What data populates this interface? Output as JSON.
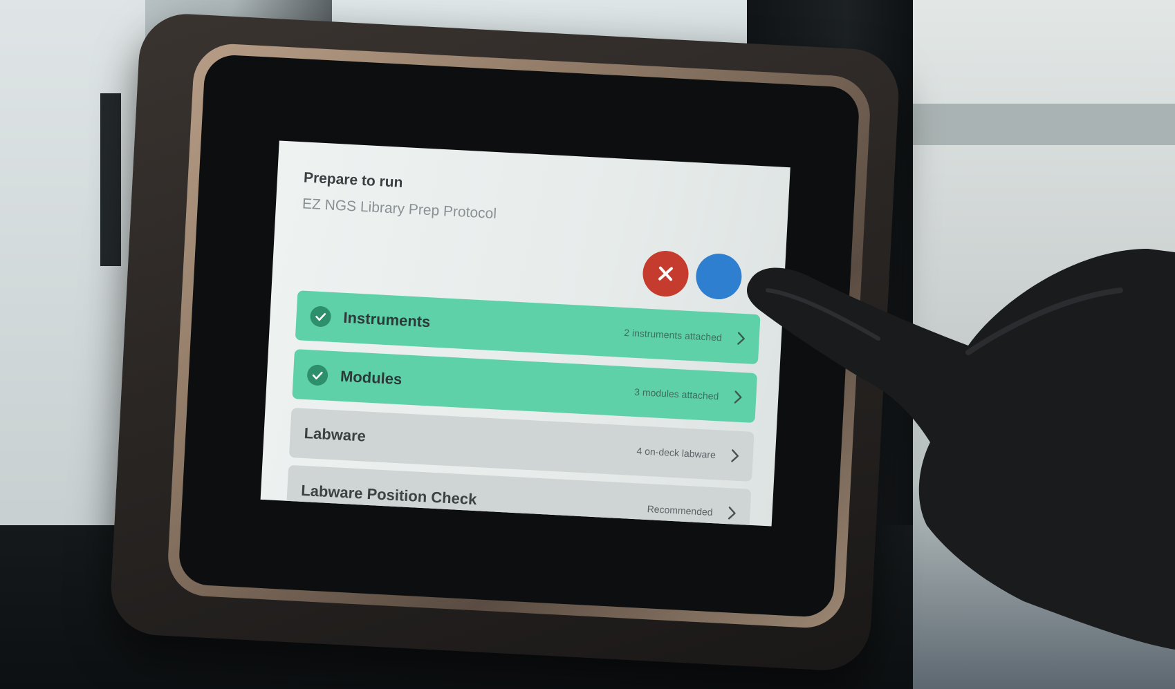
{
  "header": {
    "title": "Prepare to run",
    "subtitle": "EZ NGS Library Prep Protocol"
  },
  "actions": {
    "cancel_icon": "close-icon",
    "confirm_icon": "confirm-icon"
  },
  "setup_steps": [
    {
      "label": "Instruments",
      "status": "2 instruments attached",
      "state": "complete"
    },
    {
      "label": "Modules",
      "status": "3 modules attached",
      "state": "complete"
    },
    {
      "label": "Labware",
      "status": "4 on-deck labware",
      "state": "pending"
    },
    {
      "label": "Labware Position Check",
      "status": "Recommended",
      "state": "pending"
    }
  ],
  "colors": {
    "complete_row": "#5fd1a9",
    "pending_row": "#cfd4d4",
    "cancel_button": "#c53b2d",
    "confirm_button": "#2f7fd1",
    "check_badge": "#2e8f6d"
  }
}
